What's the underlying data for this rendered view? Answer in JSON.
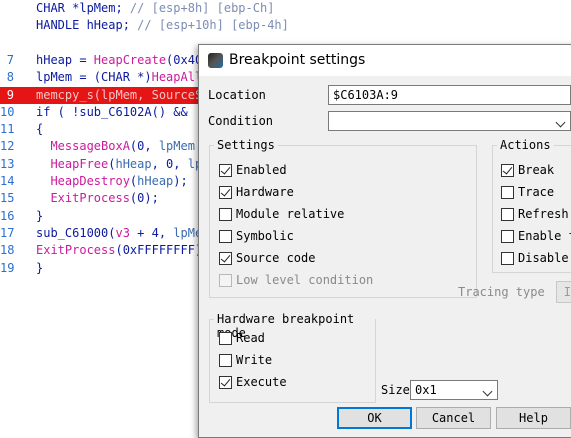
{
  "code": {
    "lines": [
      {
        "num": "",
        "tokens": [
          {
            "t": "CHAR *lpMem; ",
            "c": "c-navy"
          },
          {
            "t": "// [esp+8h] [ebp-Ch]",
            "c": "c-cmt"
          }
        ]
      },
      {
        "num": "",
        "tokens": [
          {
            "t": "HANDLE hHeap; ",
            "c": "c-navy"
          },
          {
            "t": "// [esp+10h] [ebp-4h]",
            "c": "c-cmt"
          }
        ]
      },
      {
        "num": "",
        "tokens": []
      },
      {
        "num": "7",
        "tokens": [
          {
            "t": "hHeap = ",
            "c": "c-navy"
          },
          {
            "t": "HeapCreate",
            "c": "c-fn"
          },
          {
            "t": "(0x40",
            "c": "c-navy"
          }
        ]
      },
      {
        "num": "8",
        "tokens": [
          {
            "t": "lpMem = (CHAR *)",
            "c": "c-navy"
          },
          {
            "t": "HeapAll",
            "c": "c-fn"
          }
        ]
      },
      {
        "num": "9",
        "tokens": [
          {
            "t": "memcpy_s(lpMem, SourceS",
            "c": ""
          }
        ],
        "breakpoint": true
      },
      {
        "num": "10",
        "tokens": [
          {
            "t": "if ( !",
            "c": "c-navy"
          },
          {
            "t": "sub_C6102A",
            "c": "c-navy"
          },
          {
            "t": "() && !",
            "c": "c-navy"
          }
        ]
      },
      {
        "num": "11",
        "tokens": [
          {
            "t": "{",
            "c": "c-navy"
          }
        ]
      },
      {
        "num": "12",
        "tokens": [
          {
            "t": "  MessageBoxA",
            "c": "c-fn"
          },
          {
            "t": "(0, ",
            "c": "c-navy"
          },
          {
            "t": "lpMem",
            "c": "c-var"
          }
        ]
      },
      {
        "num": "13",
        "tokens": [
          {
            "t": "  HeapFree",
            "c": "c-fn"
          },
          {
            "t": "(",
            "c": "c-navy"
          },
          {
            "t": "hHeap",
            "c": "c-var"
          },
          {
            "t": ", 0, ",
            "c": "c-navy"
          },
          {
            "t": "lp",
            "c": "c-var"
          }
        ]
      },
      {
        "num": "14",
        "tokens": [
          {
            "t": "  HeapDestroy",
            "c": "c-fn"
          },
          {
            "t": "(",
            "c": "c-navy"
          },
          {
            "t": "hHeap",
            "c": "c-var"
          },
          {
            "t": ");",
            "c": "c-navy"
          }
        ]
      },
      {
        "num": "15",
        "tokens": [
          {
            "t": "  ExitProcess",
            "c": "c-fn"
          },
          {
            "t": "(0);",
            "c": "c-navy"
          }
        ]
      },
      {
        "num": "16",
        "tokens": [
          {
            "t": "}",
            "c": "c-navy"
          }
        ]
      },
      {
        "num": "17",
        "tokens": [
          {
            "t": "sub_C61000(",
            "c": "c-navy"
          },
          {
            "t": "v3",
            "c": "c-fn"
          },
          {
            "t": " + 4, ",
            "c": "c-navy"
          },
          {
            "t": "lpMe",
            "c": "c-var"
          }
        ]
      },
      {
        "num": "18",
        "tokens": [
          {
            "t": "ExitProcess",
            "c": "c-fn"
          },
          {
            "t": "(0xFFFFFFFF)",
            "c": "c-navy"
          }
        ]
      },
      {
        "num": "19",
        "tokens": [
          {
            "t": "}",
            "c": "c-navy"
          }
        ]
      }
    ]
  },
  "dialog": {
    "title": "Breakpoint settings",
    "location_label": "Location",
    "location_value": "$C6103A:9",
    "condition_label": "Condition",
    "condition_value": "",
    "settings": {
      "title": "Settings",
      "items": [
        {
          "label": "Enabled",
          "checked": true,
          "enabled": true
        },
        {
          "label": "Hardware",
          "checked": true,
          "enabled": true
        },
        {
          "label": "Module relative",
          "checked": false,
          "enabled": true
        },
        {
          "label": "Symbolic",
          "checked": false,
          "enabled": true
        },
        {
          "label": "Source code",
          "checked": true,
          "enabled": true
        },
        {
          "label": "Low level condition",
          "checked": false,
          "enabled": false
        }
      ]
    },
    "actions": {
      "title": "Actions",
      "items": [
        {
          "label": "Break",
          "checked": true
        },
        {
          "label": "Trace",
          "checked": false
        },
        {
          "label": "Refresh d",
          "checked": false
        },
        {
          "label": "Enable tr",
          "checked": false
        },
        {
          "label": "Disable t",
          "checked": false
        }
      ]
    },
    "tracing_type_label": "Tracing type",
    "tracing_type_button": "In",
    "hw_mode": {
      "title": "Hardware breakpoint mode",
      "items": [
        {
          "label": "Read",
          "checked": false
        },
        {
          "label": "Write",
          "checked": false
        },
        {
          "label": "Execute",
          "checked": true
        }
      ]
    },
    "size_label": "Size",
    "size_value": "0x1",
    "buttons": {
      "ok": "OK",
      "cancel": "Cancel",
      "help": "Help"
    }
  }
}
